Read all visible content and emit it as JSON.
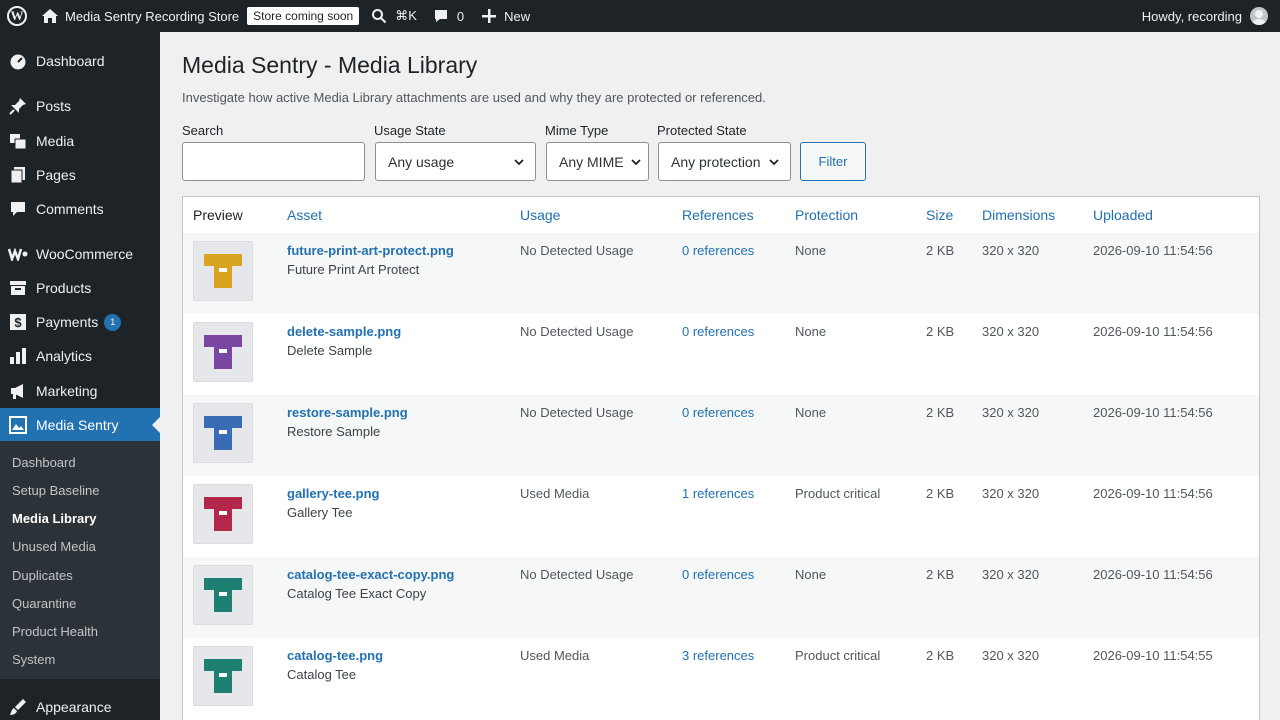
{
  "adminbar": {
    "site_name": "Media Sentry Recording Store",
    "coming_soon": "Store coming soon",
    "shortcut": "⌘K",
    "comments_count": "0",
    "new_label": "New",
    "howdy": "Howdy, recording"
  },
  "sidebar": {
    "items": [
      {
        "label": "Dashboard",
        "icon": "dashboard-icon"
      },
      {
        "label": "Posts",
        "icon": "pin-icon"
      },
      {
        "label": "Media",
        "icon": "media-icon"
      },
      {
        "label": "Pages",
        "icon": "pages-icon"
      },
      {
        "label": "Comments",
        "icon": "comment-icon"
      },
      {
        "label": "WooCommerce",
        "icon": "woo-icon"
      },
      {
        "label": "Products",
        "icon": "archive-icon"
      },
      {
        "label": "Payments",
        "icon": "dollar-icon",
        "badge": "1"
      },
      {
        "label": "Analytics",
        "icon": "chart-bar-icon"
      },
      {
        "label": "Marketing",
        "icon": "megaphone-icon"
      },
      {
        "label": "Media Sentry",
        "icon": "shield-image-icon"
      },
      {
        "label": "Appearance",
        "icon": "brush-icon"
      }
    ],
    "submenu": [
      "Dashboard",
      "Setup Baseline",
      "Media Library",
      "Unused Media",
      "Duplicates",
      "Quarantine",
      "Product Health",
      "System"
    ],
    "current_sub": "Media Library",
    "accent": "#2271b1"
  },
  "page": {
    "title": "Media Sentry - Media Library",
    "description": "Investigate how active Media Library attachments are used and why they are protected or referenced."
  },
  "filters": {
    "search_label": "Search",
    "search_value": "",
    "usage_label": "Usage State",
    "usage_value": "Any usage",
    "mime_label": "Mime Type",
    "mime_value": "Any MIME",
    "protected_label": "Protected State",
    "protected_value": "Any protection",
    "filter_button": "Filter"
  },
  "table": {
    "columns": [
      "Preview",
      "Asset",
      "Usage",
      "References",
      "Protection",
      "Size",
      "Dimensions",
      "Uploaded"
    ],
    "rows": [
      {
        "file": "future-print-art-protect.png",
        "title": "Future Print Art Protect",
        "usage": "No Detected Usage",
        "references": "0 references",
        "protection": "None",
        "size": "2 KB",
        "dimensions": "320 x 320",
        "uploaded": "2026-09-10 11:54:56",
        "color": "#d9a521"
      },
      {
        "file": "delete-sample.png",
        "title": "Delete Sample",
        "usage": "No Detected Usage",
        "references": "0 references",
        "protection": "None",
        "size": "2 KB",
        "dimensions": "320 x 320",
        "uploaded": "2026-09-10 11:54:56",
        "color": "#7b46a1"
      },
      {
        "file": "restore-sample.png",
        "title": "Restore Sample",
        "usage": "No Detected Usage",
        "references": "0 references",
        "protection": "None",
        "size": "2 KB",
        "dimensions": "320 x 320",
        "uploaded": "2026-09-10 11:54:56",
        "color": "#3a6cb5"
      },
      {
        "file": "gallery-tee.png",
        "title": "Gallery Tee",
        "usage": "Used Media",
        "references": "1 references",
        "protection": "Product critical",
        "size": "2 KB",
        "dimensions": "320 x 320",
        "uploaded": "2026-09-10 11:54:56",
        "color": "#b3284a"
      },
      {
        "file": "catalog-tee-exact-copy.png",
        "title": "Catalog Tee Exact Copy",
        "usage": "No Detected Usage",
        "references": "0 references",
        "protection": "None",
        "size": "2 KB",
        "dimensions": "320 x 320",
        "uploaded": "2026-09-10 11:54:56",
        "color": "#1e8072"
      },
      {
        "file": "catalog-tee.png",
        "title": "Catalog Tee",
        "usage": "Used Media",
        "references": "3 references",
        "protection": "Product critical",
        "size": "2 KB",
        "dimensions": "320 x 320",
        "uploaded": "2026-09-10 11:54:55",
        "color": "#1e8072"
      }
    ]
  }
}
